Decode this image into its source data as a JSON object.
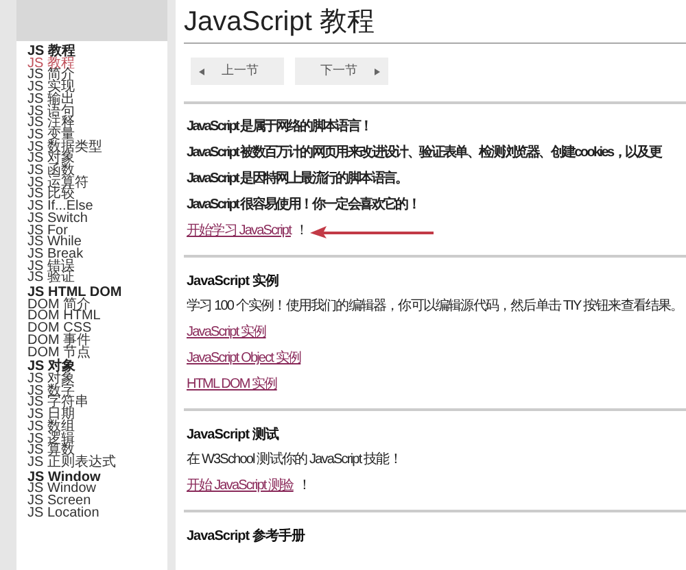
{
  "sidebar": {
    "groups": [
      {
        "heading": "JS 教程",
        "items": [
          {
            "label": "JS 教程",
            "selected": true
          },
          {
            "label": "JS 简介",
            "selected": false
          },
          {
            "label": "JS 实现",
            "selected": false
          },
          {
            "label": "JS 输出",
            "selected": false
          },
          {
            "label": "JS 语句",
            "selected": false
          },
          {
            "label": "JS 注释",
            "selected": false
          },
          {
            "label": "JS 变量",
            "selected": false
          },
          {
            "label": "JS 数据类型",
            "selected": false
          },
          {
            "label": "JS 对象",
            "selected": false
          },
          {
            "label": "JS 函数",
            "selected": false
          },
          {
            "label": "JS 运算符",
            "selected": false
          },
          {
            "label": "JS 比较",
            "selected": false
          },
          {
            "label": "JS If...Else",
            "selected": false
          },
          {
            "label": "JS Switch",
            "selected": false
          },
          {
            "label": "JS For",
            "selected": false
          },
          {
            "label": "JS While",
            "selected": false
          },
          {
            "label": "JS Break",
            "selected": false
          },
          {
            "label": "JS 错误",
            "selected": false
          },
          {
            "label": "JS 验证",
            "selected": false
          }
        ]
      },
      {
        "heading": "JS HTML DOM",
        "items": [
          {
            "label": "DOM 简介",
            "selected": false
          },
          {
            "label": "DOM HTML",
            "selected": false
          },
          {
            "label": "DOM CSS",
            "selected": false
          },
          {
            "label": "DOM 事件",
            "selected": false
          },
          {
            "label": "DOM 节点",
            "selected": false
          }
        ]
      },
      {
        "heading": "JS 对象",
        "items": [
          {
            "label": "JS 对象",
            "selected": false
          },
          {
            "label": "JS 数字",
            "selected": false
          },
          {
            "label": "JS 字符串",
            "selected": false
          },
          {
            "label": "JS 日期",
            "selected": false
          },
          {
            "label": "JS 数组",
            "selected": false
          },
          {
            "label": "JS 逻辑",
            "selected": false
          },
          {
            "label": "JS 算数",
            "selected": false
          },
          {
            "label": "JS 正则表达式",
            "selected": false
          }
        ]
      },
      {
        "heading": "JS Window",
        "items": [
          {
            "label": "JS Window",
            "selected": false
          },
          {
            "label": "JS Screen",
            "selected": false
          },
          {
            "label": "JS Location",
            "selected": false
          }
        ]
      }
    ]
  },
  "main": {
    "title": "JavaScript 教程",
    "nav_buttons": [
      {
        "label": "上一节",
        "kind": "prev"
      },
      {
        "label": "下一节",
        "kind": "next"
      }
    ],
    "sections": [
      {
        "lines": [
          {
            "kind": "bold",
            "text": "JavaScript 是属于网络的脚本语言！"
          },
          {
            "kind": "bold",
            "text": "JavaScript 被数百万计的网页用来改进设计、验证表单、检测浏览器、创建cookies，以及更"
          },
          {
            "kind": "bold",
            "text": "JavaScript 是因特网上最流行的脚本语言。"
          },
          {
            "kind": "bold",
            "text": "JavaScript 很容易使用！你一定会喜欢它的！"
          },
          {
            "kind": "link",
            "text": "开始学习 JavaScript",
            "suffix": "！",
            "pointer": true
          }
        ]
      },
      {
        "heading": "JavaScript 实例",
        "lines": [
          {
            "kind": "text",
            "text": "学习 100 个实例！使用我们的编辑器，你可以编辑源代码，然后单击 TIY 按钮来查看结果。"
          },
          {
            "kind": "link",
            "text": "JavaScript 实例"
          },
          {
            "kind": "link",
            "text": "JavaScript Object 实例"
          },
          {
            "kind": "link",
            "text": "HTML DOM 实例"
          }
        ]
      },
      {
        "heading": "JavaScript 测试",
        "lines": [
          {
            "kind": "text",
            "text": "在 W3School 测试你的 JavaScript 技能！"
          },
          {
            "kind": "link",
            "text": "开始 JavaScript 测验",
            "suffix": "！"
          }
        ]
      },
      {
        "heading": "JavaScript 参考手册"
      }
    ]
  }
}
